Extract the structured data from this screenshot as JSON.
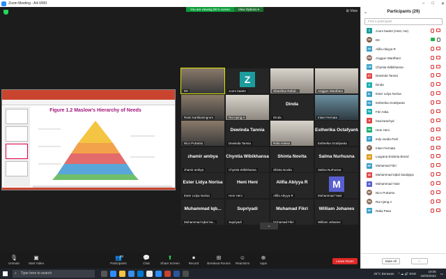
{
  "window": {
    "title": "Zoom Meeting - A4-VRIII"
  },
  "banner": {
    "viewing_label": "You are viewing DK's screen",
    "view_options": "View Options ▾"
  },
  "view_button": "⊞ View",
  "shared_slide": {
    "title": "Figure 1.2 Maslow's Hierarchy of Needs"
  },
  "tiles": [
    {
      "name": "DK",
      "big": "",
      "style": "cam"
    },
    {
      "name": "zoom baa04",
      "big": "",
      "avatar": "Z",
      "avatar_color": "#1c9c9c"
    },
    {
      "name": "Sharelina Rahal...",
      "big": "",
      "style": "cam2"
    },
    {
      "name": "Anggun Wardhani",
      "big": "",
      "style": "cam2"
    },
    {
      "name": "Ranti Kartikaningrum",
      "big": "",
      "style": "cam"
    },
    {
      "name": "Rai Ajeng A",
      "big": "",
      "style": "cam2"
    },
    {
      "name": "Dinda",
      "big": "Dinda"
    },
    {
      "name": "Intan Fermata",
      "big": "",
      "style": "cam3"
    },
    {
      "name": "Nico Putranto",
      "big": "",
      "style": "cam"
    },
    {
      "name": "Dewinda Tannia",
      "big": "Dewinda Tannia"
    },
    {
      "name": "Rafa Anissa",
      "big": "",
      "style": "cam2"
    },
    {
      "name": "Estherika Octafyanta",
      "big": "Estherika Octafyanta"
    },
    {
      "name": "zhamir ambya",
      "big": "zhamir ambya"
    },
    {
      "name": "Chyntia Wibikhansa",
      "big": "Chyntia Wibikhansa"
    },
    {
      "name": "Shinta Novita",
      "big": "Shinta Novita"
    },
    {
      "name": "Salma Nurhusna",
      "big": "Salma Nurhusna"
    },
    {
      "name": "Ester Lidya Norisa",
      "big": "Ester Lidya Norisa"
    },
    {
      "name": "Heni Heni",
      "big": "Heni Heni"
    },
    {
      "name": "Alifia Abiyya R",
      "big": "Alifia Abiyya R"
    },
    {
      "name": "Muhammad Yasir",
      "big": "",
      "avatar": "M",
      "avatar_color": "#5a5fd0"
    },
    {
      "name": "Muhammad Iqbal Sa...",
      "big": "Muhammad Iqb..."
    },
    {
      "name": "Supriyadi",
      "big": "Supriyadi"
    },
    {
      "name": "Muhamad Fikri",
      "big": "Muhamad Fikri"
    },
    {
      "name": "William Johanes",
      "big": "William Johanes"
    }
  ],
  "toolbar": {
    "unmute": "Unmute",
    "start_video": "Start Video",
    "participants": "Participants",
    "participants_count": "29",
    "chat": "Chat",
    "share_screen": "Share Screen",
    "record": "Record",
    "breakout": "Breakout Rooms",
    "reactions": "Reactions",
    "apps": "Apps",
    "leave": "Leave Room"
  },
  "panel": {
    "title": "Participants (29)",
    "search_placeholder": "Find a participant",
    "mute_all": "Mute All",
    "more": "...",
    "participants": [
      {
        "initials": "Z",
        "name": "zoom baa04 (Host, me)",
        "color": "#1c9c9c",
        "muted": true,
        "video": false
      },
      {
        "initials": "DK",
        "name": "DK",
        "color": "#7a5c4a",
        "muted": false,
        "video": true,
        "photo": true
      },
      {
        "initials": "AA",
        "name": "Alifia Abiyya R",
        "color": "#3aa0c8",
        "muted": true,
        "video": false
      },
      {
        "initials": "AW",
        "name": "Anggun Wardhani",
        "color": "#8a6a5a",
        "muted": true,
        "video": false,
        "photo": true
      },
      {
        "initials": "CW",
        "name": "Chyntia Wibikhansa",
        "color": "#3aa0c8",
        "muted": true,
        "video": false
      },
      {
        "initials": "DT",
        "name": "Dewinda Tannia",
        "color": "#e04848",
        "muted": true,
        "video": false
      },
      {
        "initials": "D",
        "name": "Dinda",
        "color": "#1cb0b0",
        "muted": true,
        "video": false
      },
      {
        "initials": "EL",
        "name": "Ester Lidya Norisa",
        "color": "#3aa0c8",
        "muted": true,
        "video": false
      },
      {
        "initials": "EO",
        "name": "Estherika Octafyanta",
        "color": "#3aa0c8",
        "muted": true,
        "video": false
      },
      {
        "initials": "FA",
        "name": "Fitri Atika",
        "color": "#1cb0b0",
        "muted": true,
        "video": false
      },
      {
        "initials": "H",
        "name": "havizarachyd",
        "color": "#e04848",
        "muted": true,
        "video": false
      },
      {
        "initials": "HH",
        "name": "Heni Heni",
        "color": "#1cb070",
        "muted": true,
        "video": false
      },
      {
        "initials": "IP",
        "name": "indy ravida Putri",
        "color": "#3aa0c8",
        "muted": true,
        "video": false
      },
      {
        "initials": "IF",
        "name": "Intan Fermata",
        "color": "#8a6a5a",
        "muted": true,
        "video": false,
        "photo": true
      },
      {
        "initials": "LE",
        "name": "Luqyana Erdanta Brand",
        "color": "#e0a020",
        "muted": true,
        "video": false
      },
      {
        "initials": "MF",
        "name": "Muhamad Fikri",
        "color": "#3aa0c8",
        "muted": true,
        "video": false
      },
      {
        "initials": "MI",
        "name": "Muhammad Iqbal Sandjaya",
        "color": "#e04848",
        "muted": true,
        "video": false
      },
      {
        "initials": "M",
        "name": "Muhammad Yasir",
        "color": "#5a5fd0",
        "muted": true,
        "video": false
      },
      {
        "initials": "NP",
        "name": "Nico Putranto",
        "color": "#8a6a5a",
        "muted": true,
        "video": false,
        "photo": true
      },
      {
        "initials": "RA",
        "name": "Rai Ajeng A",
        "color": "#8a6a5a",
        "muted": true,
        "video": false,
        "photo": true
      },
      {
        "initials": "RP",
        "name": "Raka Pasa",
        "color": "#3aa0c8",
        "muted": true,
        "video": false
      }
    ]
  },
  "taskbar": {
    "search_placeholder": "Type here to search",
    "weather": "25°C Berawan",
    "time": "19:05",
    "date": "10/03/2022"
  },
  "colors": {
    "accent_green": "#23d959",
    "leave_red": "#e02828",
    "muted_red": "#e02828"
  }
}
